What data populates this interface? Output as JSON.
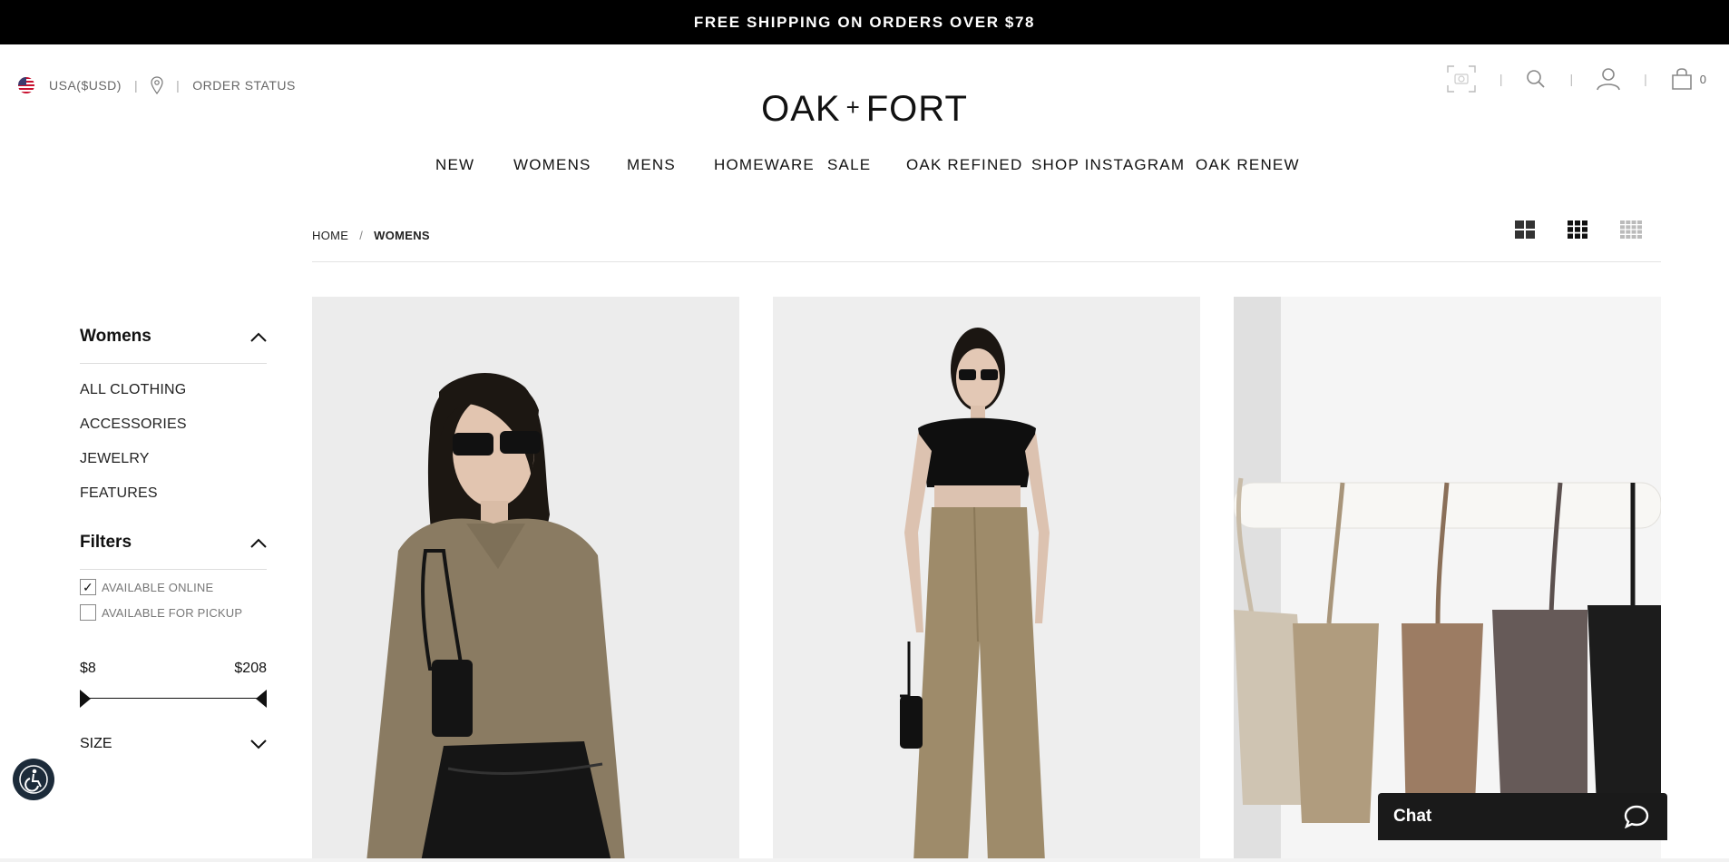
{
  "promo": {
    "text": "FREE SHIPPING ON ORDERS OVER $78"
  },
  "utility": {
    "currency": "USA($USD)",
    "order_status": "ORDER STATUS",
    "cart_count": "0",
    "icons": [
      "flag-us-icon",
      "location-pin-icon",
      "camera-search-icon",
      "search-icon",
      "account-icon",
      "cart-icon"
    ]
  },
  "logo": {
    "left": "OAK",
    "plus": "+",
    "right": "FORT"
  },
  "nav": {
    "items": [
      {
        "label": "NEW"
      },
      {
        "label": "WOMENS"
      },
      {
        "label": "MENS"
      },
      {
        "label": "HOMEWARE"
      },
      {
        "label": "SALE"
      },
      {
        "label": "OAK REFINED"
      },
      {
        "label": "SHOP INSTAGRAM"
      },
      {
        "label": "OAK RENEW"
      }
    ]
  },
  "breadcrumb": {
    "home": "HOME",
    "separator": "/",
    "current": "WOMENS"
  },
  "view_toggles": [
    "grid-2-icon",
    "grid-3-icon",
    "grid-4-icon"
  ],
  "sidebar": {
    "category_title": "Womens",
    "links": [
      "ALL CLOTHING",
      "ACCESSORIES",
      "JEWELRY",
      "FEATURES"
    ],
    "filters_title": "Filters",
    "available_online": "AVAILABLE ONLINE",
    "available_online_checked": true,
    "available_pickup": "AVAILABLE FOR PICKUP",
    "available_pickup_checked": false,
    "price_min": "$8",
    "price_max": "$208",
    "size_label": "SIZE"
  },
  "chat": {
    "label": "Chat"
  },
  "colors": {
    "promo_bg": "#000000",
    "chat_bg": "#1a1a1a",
    "accessibility_bg": "#1c2b3a"
  }
}
